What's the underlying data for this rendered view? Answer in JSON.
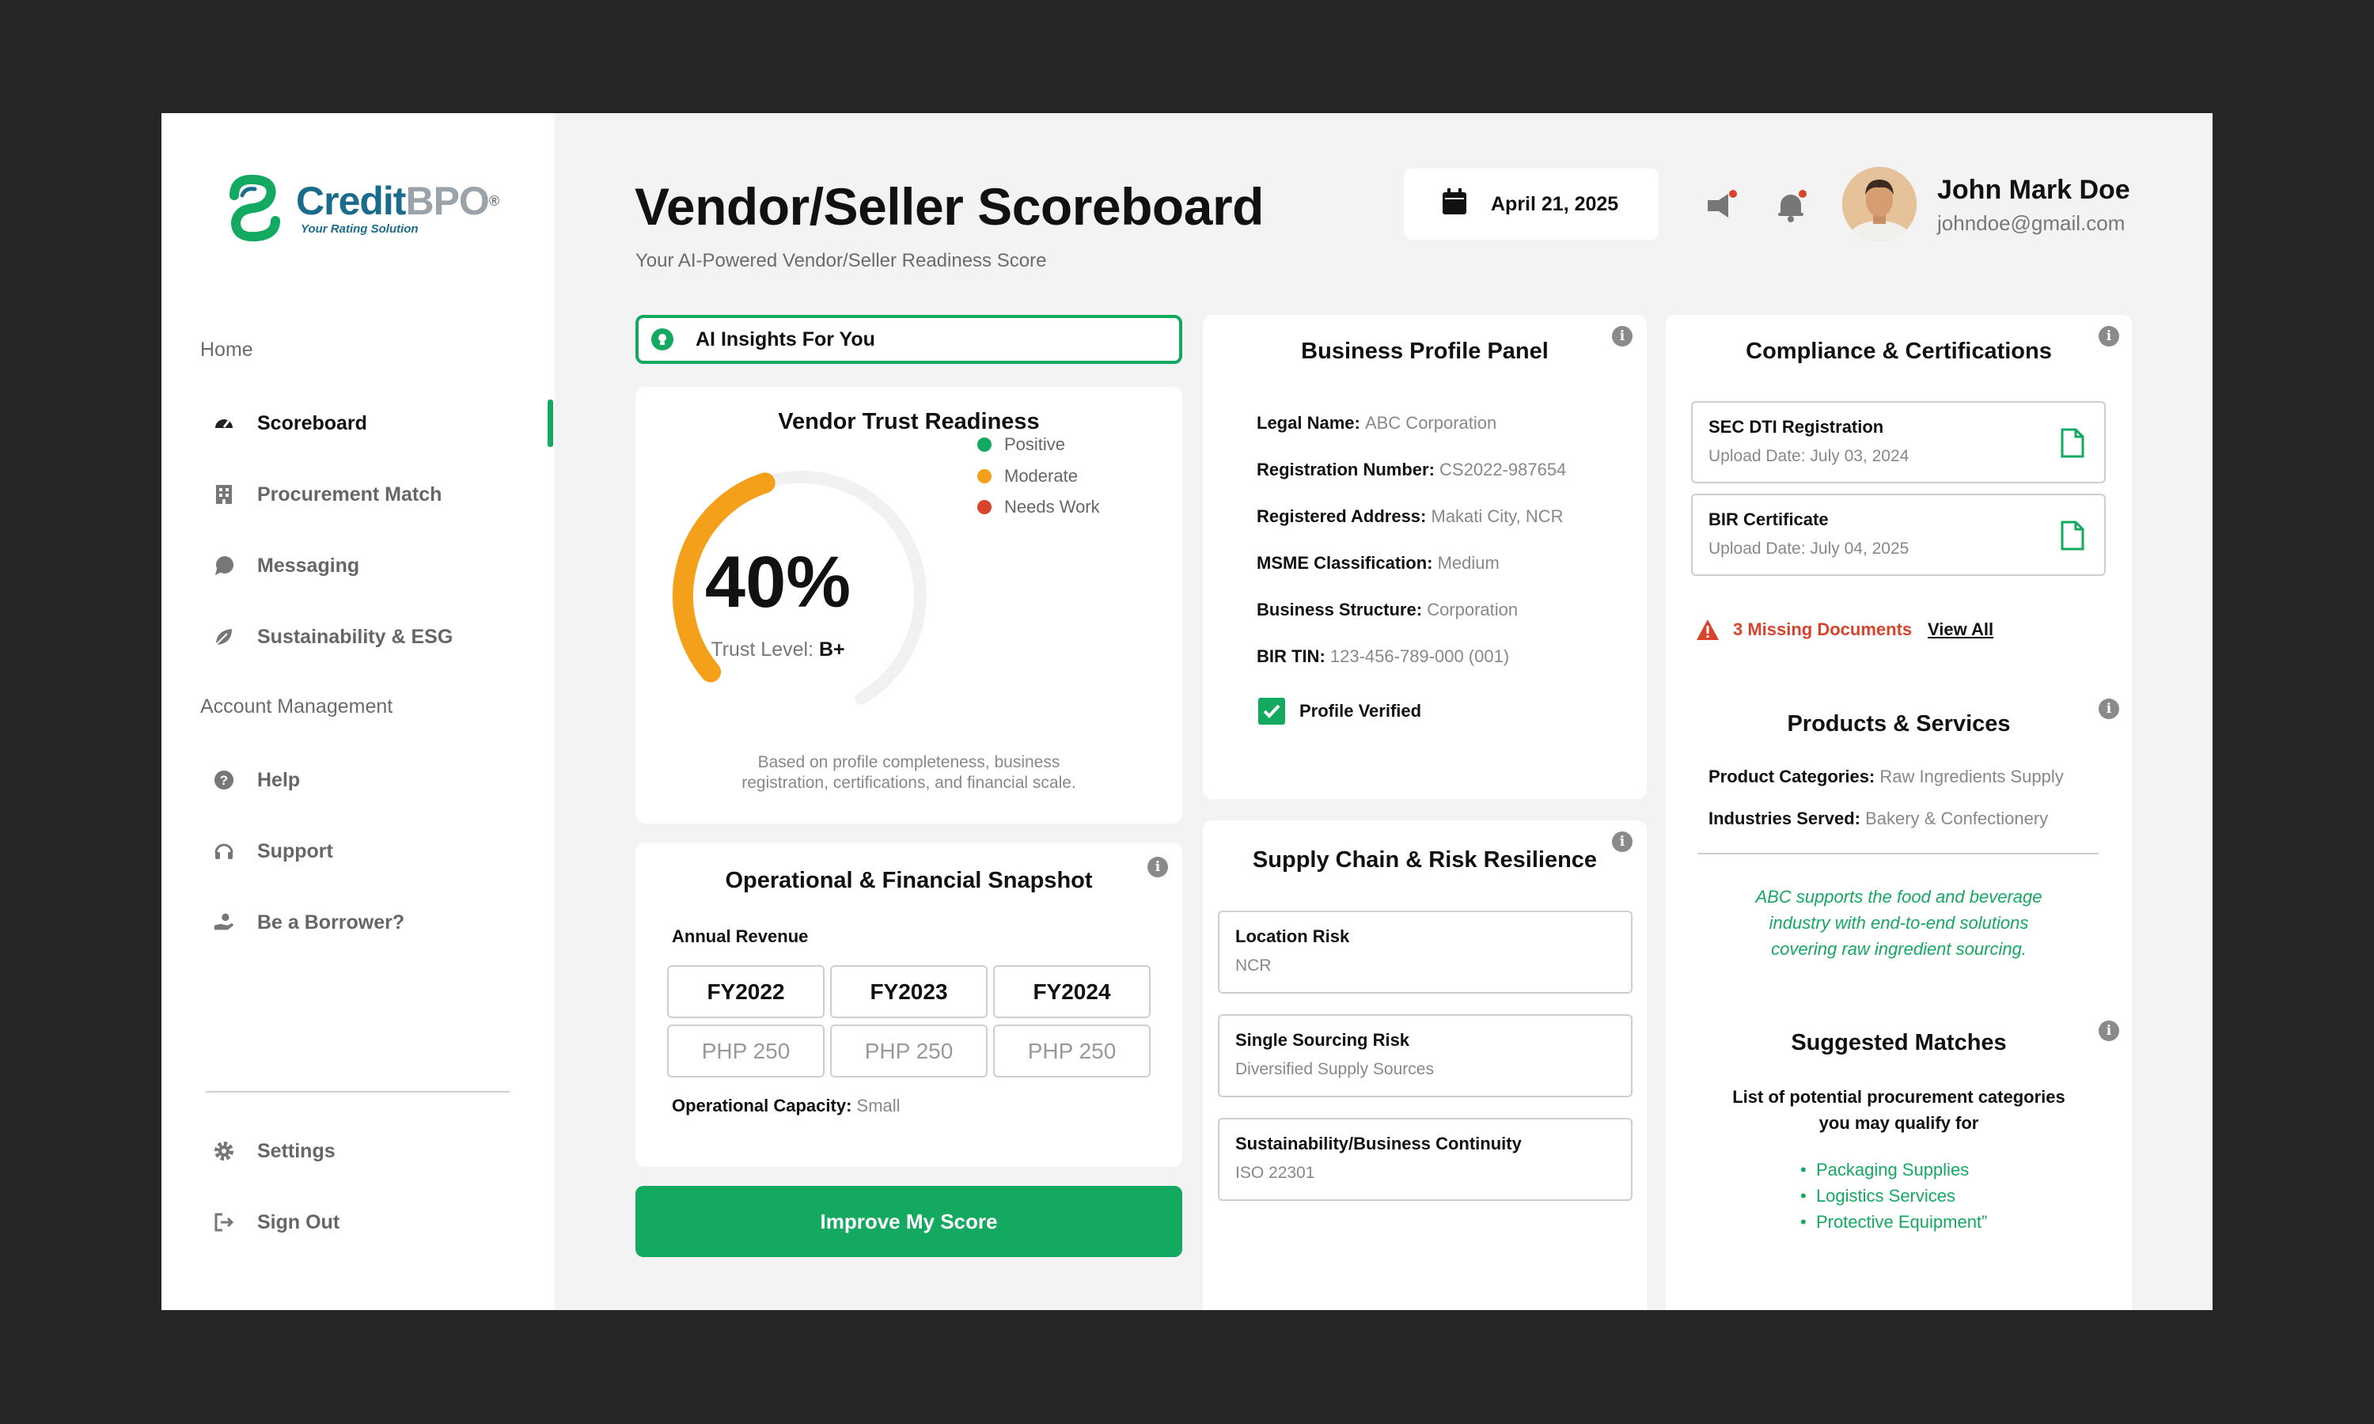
{
  "brand": {
    "name_part1": "Credit",
    "name_part2": "BPO",
    "reg": "®",
    "tagline": "Your Rating Solution"
  },
  "sidebar": {
    "section_home": "Home",
    "items": [
      {
        "label": "Scoreboard",
        "icon": "gauge-icon",
        "active": true
      },
      {
        "label": "Procurement Match",
        "icon": "building-icon"
      },
      {
        "label": "Messaging",
        "icon": "chat-bubble-icon"
      },
      {
        "label": "Sustainability & ESG",
        "icon": "leaf-icon"
      }
    ],
    "section_account": "Account Management",
    "account_items": [
      {
        "label": "Help",
        "icon": "question-icon"
      },
      {
        "label": "Support",
        "icon": "headset-icon"
      },
      {
        "label": "Be a Borrower?",
        "icon": "hand-coin-icon"
      }
    ],
    "bottom_items": [
      {
        "label": "Settings",
        "icon": "gear-icon"
      },
      {
        "label": "Sign Out",
        "icon": "sign-out-icon"
      }
    ]
  },
  "header": {
    "title": "Vendor/Seller Scoreboard",
    "subtitle": "Your AI-Powered Vendor/Seller Readiness Score",
    "date": "April 21, 2025",
    "user_name": "John Mark Doe",
    "user_email": "johndoe@gmail.com"
  },
  "ai_insights": {
    "label": "AI Insights For You"
  },
  "trust": {
    "title": "Vendor Trust Readiness",
    "percent_label": "40%",
    "percent_value": 40,
    "level_label": "Trust Level:",
    "level_value": "B+",
    "legend": [
      {
        "label": "Positive",
        "color": "#14a960"
      },
      {
        "label": "Moderate",
        "color": "#f5a01a"
      },
      {
        "label": "Needs Work",
        "color": "#d9432b"
      }
    ],
    "note_line1": "Based on profile completeness, business",
    "note_line2": "registration, certifications, and financial scale."
  },
  "operational": {
    "title": "Operational & Financial Snapshot",
    "revenue_label": "Annual Revenue",
    "years": [
      "FY2022",
      "FY2023",
      "FY2024"
    ],
    "values": [
      "PHP 250",
      "PHP 250",
      "PHP 250"
    ],
    "capacity_label": "Operational Capacity:",
    "capacity_value": "Small"
  },
  "improve_button": "Improve My Score",
  "profile": {
    "title": "Business Profile Panel",
    "fields": [
      {
        "k": "Legal Name:",
        "v": "ABC Corporation"
      },
      {
        "k": "Registration Number:",
        "v": "CS2022-987654"
      },
      {
        "k": "Registered Address:",
        "v": "Makati City, NCR"
      },
      {
        "k": "MSME Classification:",
        "v": "Medium"
      },
      {
        "k": "Business Structure:",
        "v": "Corporation"
      },
      {
        "k": "BIR TIN:",
        "v": "123-456-789-000 (001)"
      }
    ],
    "verified_label": "Profile Verified"
  },
  "supply": {
    "title": "Supply Chain & Risk Resilience",
    "items": [
      {
        "t": "Location Risk",
        "s": "NCR"
      },
      {
        "t": "Single Sourcing Risk",
        "s": "Diversified Supply Sources"
      },
      {
        "t": "Sustainability/Business Continuity",
        "s": "ISO 22301"
      }
    ]
  },
  "compliance": {
    "title": "Compliance & Certifications",
    "docs": [
      {
        "t": "SEC DTI Registration",
        "s": "Upload Date: July 03, 2024"
      },
      {
        "t": "BIR Certificate",
        "s": "Upload Date: July 04, 2025"
      }
    ],
    "missing": "3 Missing Documents",
    "view_all": "View All"
  },
  "products": {
    "title": "Products & Services",
    "cat_label": "Product Categories:",
    "cat_value": "Raw Ingredients Supply",
    "ind_label": "Industries Served:",
    "ind_value": "Bakery & Confectionery",
    "desc_line1": "ABC supports the food and beverage",
    "desc_line2": "industry with end-to-end solutions",
    "desc_line3": "covering raw ingredient sourcing."
  },
  "matches": {
    "title": "Suggested Matches",
    "desc_line1": "List of potential procurement categories",
    "desc_line2": "you may qualify for",
    "items": [
      "Packaging Supplies",
      "Logistics Services",
      "Protective Equipment”"
    ]
  },
  "colors": {
    "accent": "#14a960",
    "warning": "#f5a01a",
    "danger": "#d9432b",
    "brand_blue": "#1b6b8c"
  }
}
